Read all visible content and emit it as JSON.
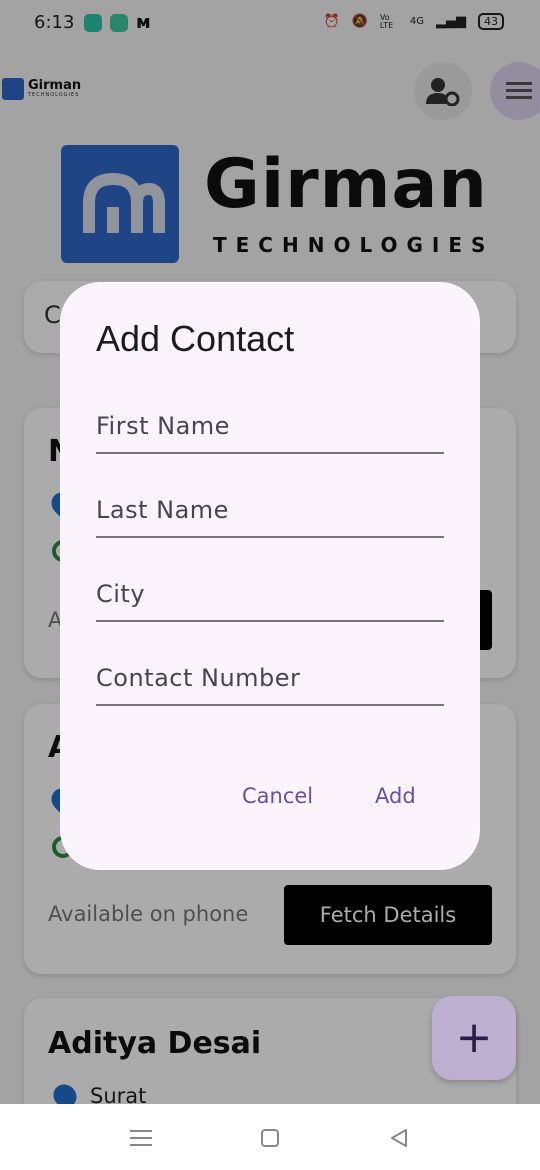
{
  "status_bar": {
    "time": "6:13",
    "battery": "43",
    "network": "4G",
    "volte": "Vo LTE"
  },
  "header": {
    "logo_name": "Girman",
    "logo_sub": "TECHNOLOGIES"
  },
  "banner": {
    "name": "Girman",
    "sub": "TECHNOLOGIES"
  },
  "background": {
    "search_partial": "C",
    "card1_name_partial": "N",
    "card1_avail_partial": "A",
    "card2_name_partial": "A",
    "card2_avail": "Available on phone",
    "card2_button": "Fetch Details",
    "card3_name": "Aditya Desai",
    "card3_city": "Surat"
  },
  "dialog": {
    "title": "Add Contact",
    "fields": [
      {
        "placeholder": "First Name",
        "value": ""
      },
      {
        "placeholder": "Last Name",
        "value": ""
      },
      {
        "placeholder": "City",
        "value": ""
      },
      {
        "placeholder": "Contact Number",
        "value": ""
      }
    ],
    "cancel_label": "Cancel",
    "add_label": "Add"
  },
  "fab": {
    "label": "+"
  },
  "colors": {
    "accent": "#6750a4",
    "logo_blue": "#3068c9",
    "dialog_bg": "#fcf4fc"
  }
}
